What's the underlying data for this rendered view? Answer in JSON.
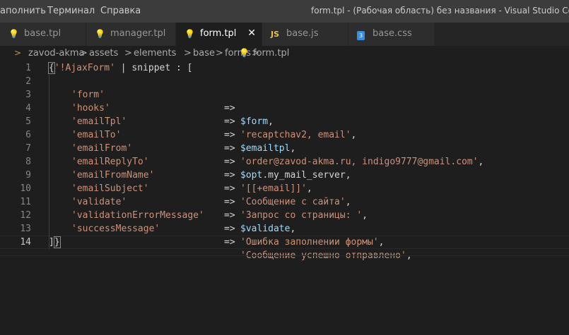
{
  "menu": {
    "items": [
      "аполнить",
      "Терминал",
      "Справка"
    ]
  },
  "window_title": "form.tpl - (Рабочая область) без названия - Visual Studio Code",
  "tabs": [
    {
      "label": "base.tpl",
      "icon": "lightbulb-icon"
    },
    {
      "label": "manager.tpl",
      "icon": "lightbulb-icon"
    },
    {
      "label": "form.tpl",
      "icon": "lightbulb-icon",
      "active": true,
      "close": "✕"
    },
    {
      "label": "base.js",
      "icon": "js-icon",
      "icon_text": "JS"
    },
    {
      "label": "base.css",
      "icon": "css-icon"
    }
  ],
  "breadcrumb": [
    "zavod-akma",
    "assets",
    "elements",
    "base",
    "forms",
    "form.tpl"
  ],
  "breadcrumb_sep": ">",
  "editor": {
    "current_line": 14,
    "line_numbers": [
      "1",
      "2",
      "3",
      "4",
      "5",
      "6",
      "7",
      "8",
      "9",
      "10",
      "11",
      "12",
      "13",
      "14"
    ],
    "line1": {
      "brace": "{",
      "str": "'!AjaxForm'",
      "rest": " | snippet : ["
    },
    "rows": [
      {
        "key": "'form'",
        "arrow": "=>",
        "var": "$form",
        "tail": ","
      },
      {
        "key": "'hooks'",
        "arrow": "=>",
        "str": "'recaptchav2, email'",
        "tail": ","
      },
      {
        "key": "'emailTpl'",
        "arrow": "=>",
        "var": "$emailtpl",
        "tail": ","
      },
      {
        "key": "'emailTo'",
        "arrow": "=>",
        "str": "'order@zavod-akma.ru, indigo9777@gmail.com'",
        "tail": ","
      },
      {
        "key": "'emailFrom'",
        "arrow": "=>",
        "var": "$opt",
        "tail": ".my_mail_server,"
      },
      {
        "key": "'emailReplyTo'",
        "arrow": "=>",
        "str": "'[[+email]]'",
        "tail": ","
      },
      {
        "key": "'emailFromName'",
        "arrow": "=>",
        "str": "'Сообщение с сайта'",
        "tail": ","
      },
      {
        "key": "'emailSubject'",
        "arrow": "=>",
        "str": "'Запрос со страницы: '",
        "tail": ","
      },
      {
        "key": "'validate'",
        "arrow": "=>",
        "var": "$validate",
        "tail": ","
      },
      {
        "key": "'validationErrorMessage'",
        "arrow": "=>",
        "str": "'Ошибка заполнении формы'",
        "tail": ","
      },
      {
        "key": "'successMessage'",
        "arrow": "=>",
        "str": "'Сообщение успешно отправлено'",
        "tail": ","
      }
    ],
    "line14": {
      "bracket": "]",
      "brace": "}"
    }
  },
  "colors": {
    "background": "#1e1e1e",
    "string": "#ce9178",
    "variable": "#9cdcfe",
    "text": "#d4d4d4",
    "line_number": "#858585"
  }
}
